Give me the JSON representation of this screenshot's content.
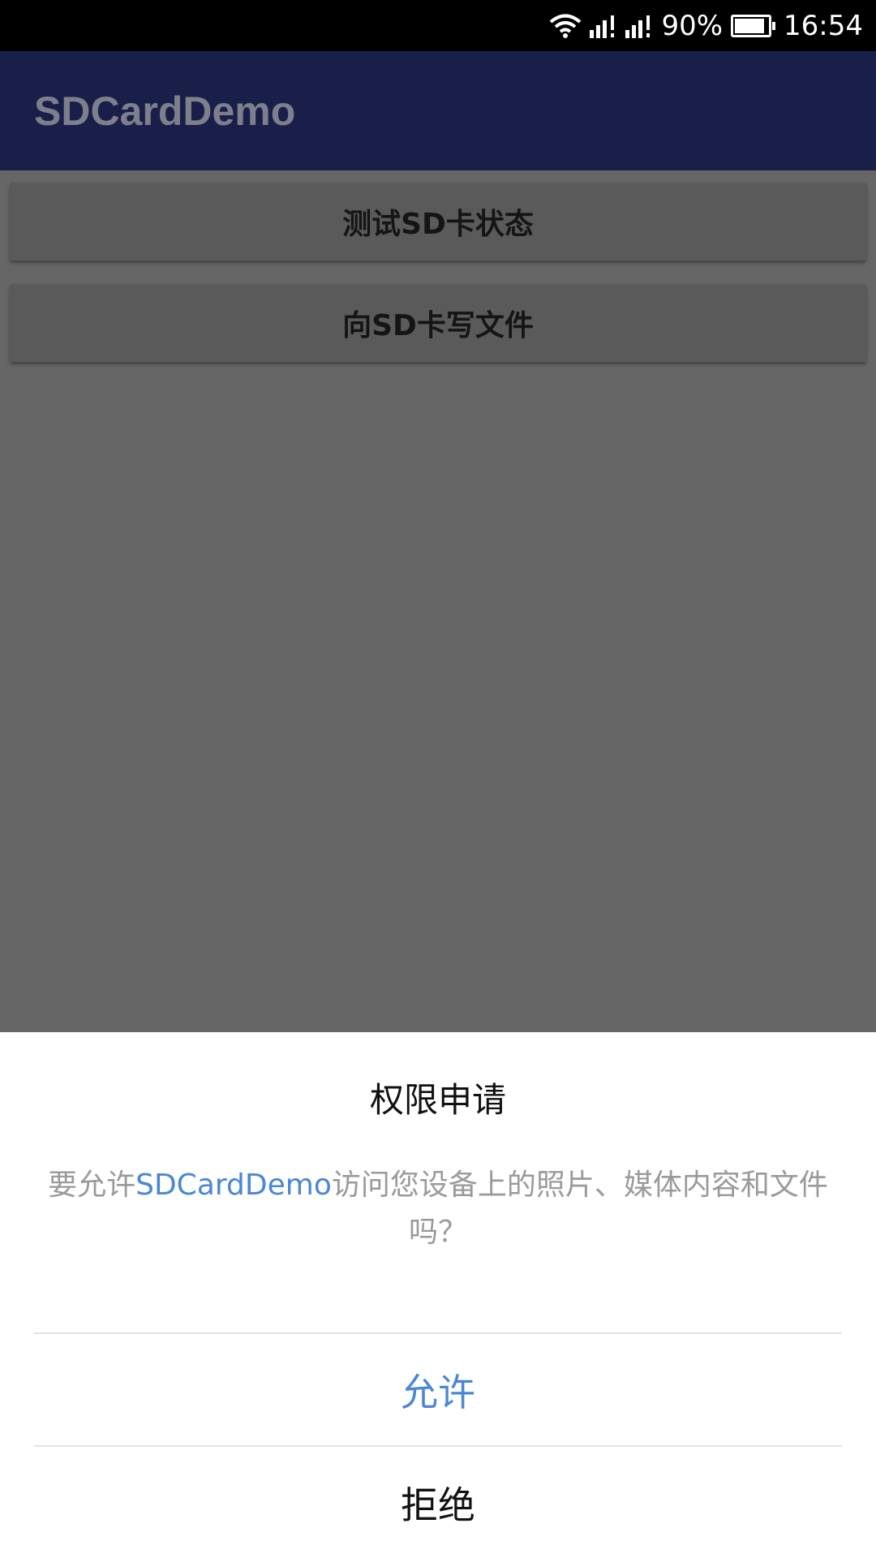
{
  "status_bar": {
    "battery_percent": "90%",
    "battery_level": 0.9,
    "time": "16:54",
    "icons": [
      "wifi-icon",
      "signal-icon",
      "signal-icon",
      "battery-icon"
    ]
  },
  "app_bar": {
    "title": "SDCardDemo"
  },
  "buttons": {
    "test_sd_status": "测试SD卡状态",
    "write_sd_file": "向SD卡写文件"
  },
  "dialog": {
    "title": "权限申请",
    "message_prefix": "要允许",
    "message_app_name": "SDCardDemo",
    "message_suffix": "访问您设备上的照片、媒体内容和文件吗？",
    "allow_label": "允许",
    "deny_label": "拒绝"
  },
  "colors": {
    "accent": "#4a86d6",
    "app_bar": "#1a1f4a",
    "scrim": "#666666"
  }
}
